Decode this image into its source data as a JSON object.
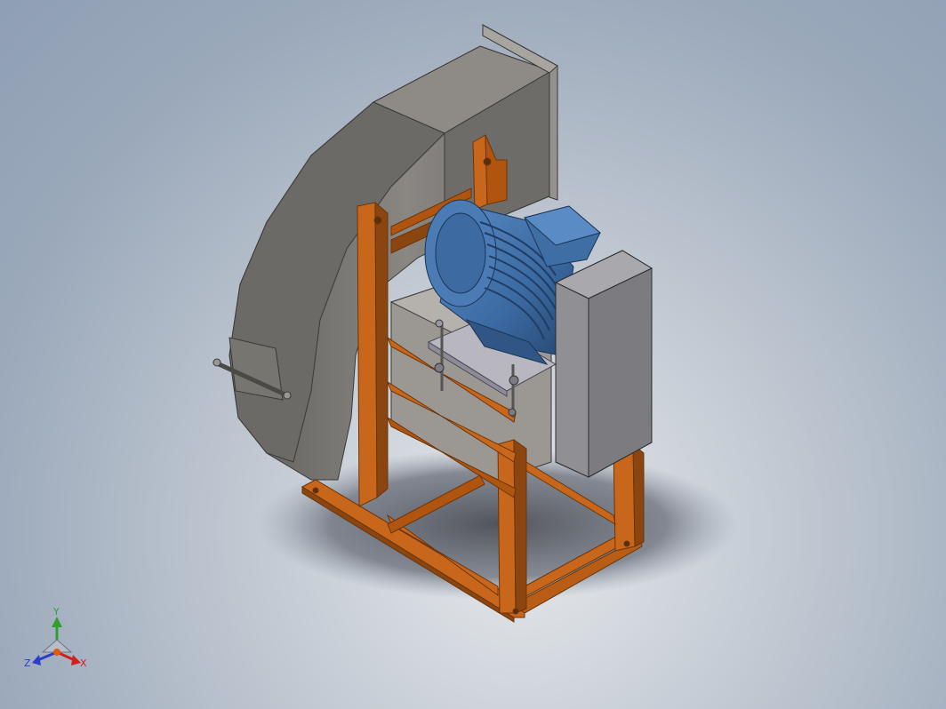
{
  "viewport": {
    "background_top": "#8f9fb4",
    "background_bottom": "#e6e9ec"
  },
  "model": {
    "description_icon": "centrifugal-fan-assembly",
    "colors": {
      "housing": "#7d7b78",
      "housing_light": "#9c9995",
      "frame": "#c8671c",
      "frame_dark": "#8a4510",
      "motor": "#3f6ea5",
      "motor_dark": "#24466f",
      "panel": "#76767a",
      "plate": "#b8b6bf"
    }
  },
  "triad": {
    "y_label": "Y",
    "z_label": "Z",
    "x_label": "X",
    "y_color": "#2fa02f",
    "z_color": "#2a3ec8",
    "x_color": "#d02020"
  }
}
